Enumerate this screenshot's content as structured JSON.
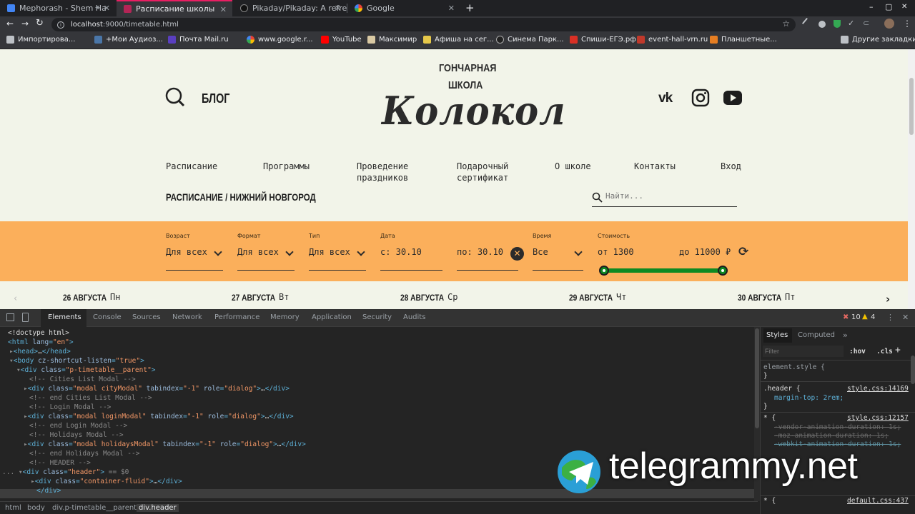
{
  "browser": {
    "tabs": [
      {
        "title": "Mephorash - Shem Ha",
        "icon": "youtube-music-icon"
      },
      {
        "title": "Расписание школы",
        "icon": "page-icon"
      },
      {
        "title": "Pikaday/Pikaday: A refre",
        "icon": "github-icon"
      },
      {
        "title": "Google",
        "icon": "google-icon"
      }
    ],
    "new_tab": "+",
    "address": {
      "host": "localhost",
      "rest": ":9000/timetable.html"
    },
    "bookmarks": [
      "Импортирова...",
      "+Мои Аудиоз...",
      "Почта Mail.ru",
      "www.google.r...",
      "YouTube",
      "Максимир",
      "Афиша на сег...",
      "Синема Парк...",
      "Спиши-ЕГЭ.рф",
      "event-hall-vrn.ru",
      "Планшетные...",
      "Другие закладки"
    ],
    "window_controls": [
      "–",
      "▢",
      "✕"
    ]
  },
  "site": {
    "blog": "БЛОГ",
    "logo_top": "ГОНЧАРНАЯ",
    "logo_mid": "ШКОЛА",
    "logo_main": "Колокол",
    "nav": [
      "Расписание",
      "Программы",
      "Проведение праздников",
      "Подарочный сертификат",
      "О школе",
      "Контакты",
      "Вход"
    ],
    "heading": "РАСПИСАНИЕ / НИЖНИЙ НОВГОРОД",
    "search_placeholder": "Найти...",
    "filters": {
      "age": {
        "label": "Возраст",
        "value": "Для всех"
      },
      "format": {
        "label": "Формат",
        "value": "Для всех"
      },
      "type": {
        "label": "Тип",
        "value": "Для всех"
      },
      "date": {
        "label": "Дата",
        "from": "с: 30.10",
        "to": "по: 30.10"
      },
      "time": {
        "label": "Время",
        "value": "Все"
      },
      "cost": {
        "label": "Стоимость",
        "from": "от 1300",
        "to": "до 11000 ₽",
        "range_fraction": [
          0.0,
          1.0
        ]
      }
    },
    "days": [
      {
        "date": "26 АВГУСТА",
        "wd": "Пн"
      },
      {
        "date": "27 АВГУСТА",
        "wd": "Вт"
      },
      {
        "date": "28 АВГУСТА",
        "wd": "Ср"
      },
      {
        "date": "29 АВГУСТА",
        "wd": "Чт"
      },
      {
        "date": "30 АВГУСТА",
        "wd": "Пт"
      }
    ]
  },
  "devtools": {
    "tabs": [
      "Elements",
      "Console",
      "Sources",
      "Network",
      "Performance",
      "Memory",
      "Application",
      "Security",
      "Audits"
    ],
    "errors": "10",
    "warnings": "4",
    "styles_tabs": [
      "Styles",
      "Computed"
    ],
    "filter_placeholder": "Filter",
    "hov": ":hov",
    "cls": ".cls",
    "crumbs": [
      "html",
      "body",
      "div.p-timetable__parent",
      "div.header"
    ],
    "element_style": "element.style {",
    "rule1_sel": ".header {",
    "rule1_src": "style.css:14169",
    "rule1_prop": "margin-top: 2rem;",
    "rule2_sel": "* {",
    "rule2_src": "style.css:12157",
    "rule2_props": [
      "-vendor-animation-duration: 1s;",
      "-moz-animation-duration: 1s;",
      "-webkit-animation-duration: 1s;"
    ],
    "rule3_src": "default.css:437",
    "close_brace": "}"
  },
  "watermark": "telegrammy.net"
}
